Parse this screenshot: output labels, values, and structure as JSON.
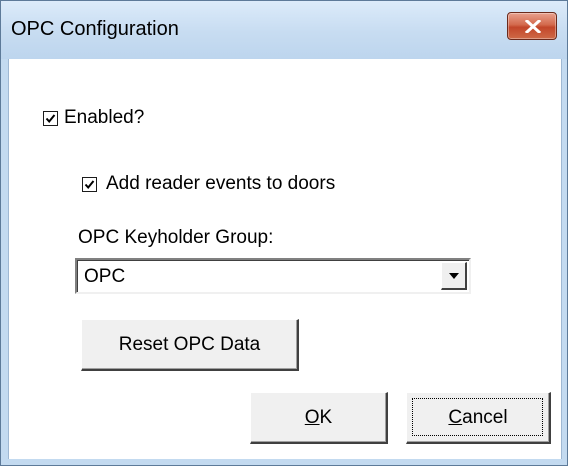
{
  "window": {
    "title": "OPC Configuration"
  },
  "icons": {
    "close": "close-icon",
    "check": "checkmark-icon",
    "dropdown": "chevron-down-icon"
  },
  "colors": {
    "title_bar": "#c7dcf1",
    "close_button": "#c2462a",
    "client_background": "#ffffff",
    "button_face": "#f0f0f0"
  },
  "form": {
    "enabled": {
      "label": "Enabled?",
      "checked": true
    },
    "add_reader_events": {
      "label": "Add reader events to doors",
      "checked": true
    },
    "keyholder_group": {
      "label": "OPC Keyholder Group:",
      "value": "OPC"
    },
    "reset_button_label": "Reset OPC Data"
  },
  "dialog_buttons": {
    "ok_label": "OK",
    "cancel_label": "Cancel"
  }
}
